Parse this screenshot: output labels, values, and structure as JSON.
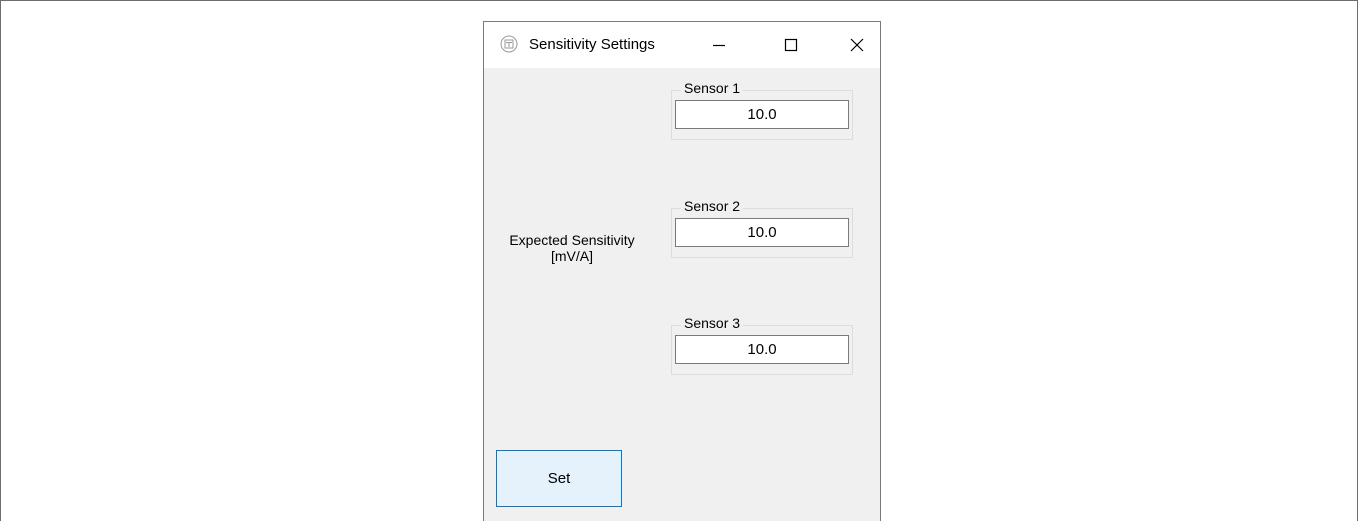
{
  "window": {
    "title": "Sensitivity Settings",
    "icon": "app-icon"
  },
  "titlebar_controls": {
    "minimize_icon": "minimize-icon",
    "maximize_icon": "maximize-icon",
    "close_icon": "close-icon"
  },
  "main": {
    "label_line1": "Expected Sensitivity",
    "label_line2": "[mV/A]",
    "sensors": [
      {
        "label": "Sensor 1",
        "value": "10.0"
      },
      {
        "label": "Sensor 2",
        "value": "10.0"
      },
      {
        "label": "Sensor 3",
        "value": "10.0"
      }
    ]
  },
  "actions": {
    "set_label": "Set"
  },
  "colors": {
    "window_bg": "#f0f0f0",
    "button_bg": "#e5f1fb",
    "button_border": "#0078d7"
  }
}
